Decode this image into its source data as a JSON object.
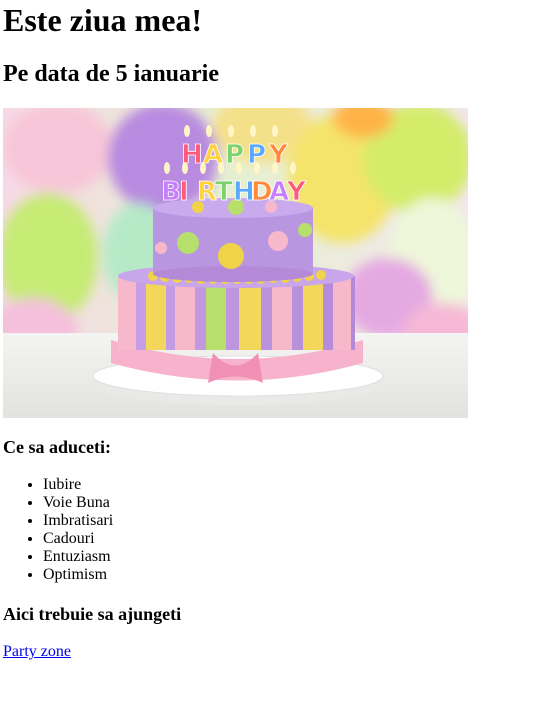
{
  "page": {
    "title": "Este ziua mea!",
    "date_line": "Pe data de 5 ianuarie"
  },
  "hero_image": {
    "candle_text": "HAPPY BIRTHDAY",
    "candle_colors": [
      "#ff5a7a",
      "#ffd23f",
      "#7cd36b",
      "#5aa9ff",
      "#ff8a3d",
      "#c77dff"
    ]
  },
  "bring_section": {
    "heading": "Ce sa aduceti:",
    "items": [
      "Iubire",
      "Voie Buna",
      "Imbratisari",
      "Cadouri",
      "Entuziasm",
      "Optimism"
    ]
  },
  "location_section": {
    "heading": "Aici trebuie sa ajungeti",
    "link_text": "Party zone"
  }
}
